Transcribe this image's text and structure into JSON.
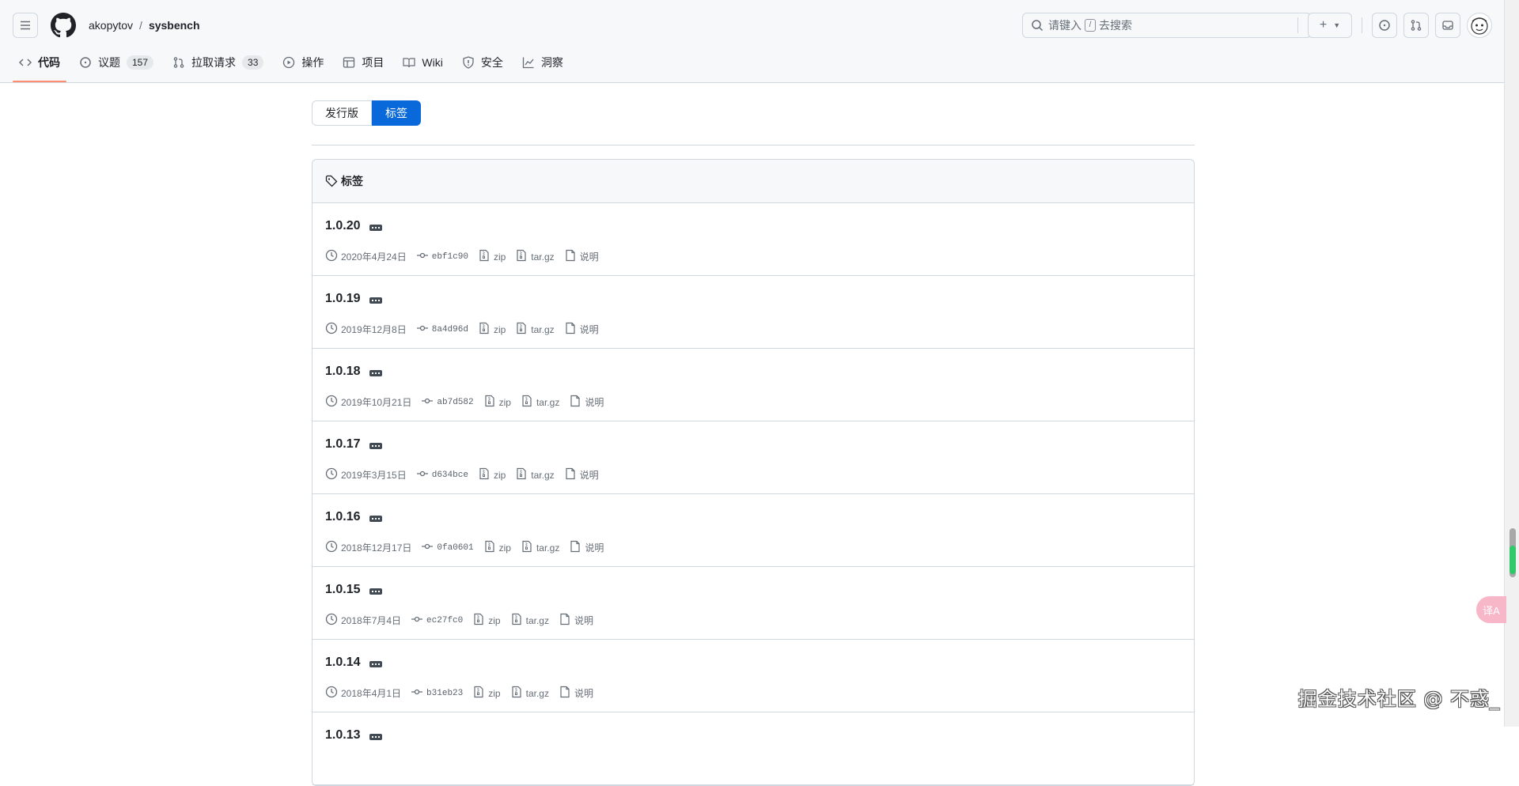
{
  "repo": {
    "owner": "akopytov",
    "separator": "/",
    "name": "sysbench"
  },
  "search": {
    "prefix": "请键入",
    "key": "/",
    "suffix": "去搜索"
  },
  "nav": {
    "tabs": [
      {
        "label": "代码",
        "icon": "code-icon"
      },
      {
        "label": "议题",
        "icon": "issue-icon",
        "count": "157"
      },
      {
        "label": "拉取请求",
        "icon": "pull-request-icon",
        "count": "33"
      },
      {
        "label": "操作",
        "icon": "play-icon"
      },
      {
        "label": "项目",
        "icon": "table-icon"
      },
      {
        "label": "Wiki",
        "icon": "book-icon"
      },
      {
        "label": "安全",
        "icon": "shield-icon"
      },
      {
        "label": "洞察",
        "icon": "graph-icon"
      }
    ]
  },
  "segmented": {
    "releases": "发行版",
    "tags": "标签"
  },
  "box": {
    "title": "标签"
  },
  "tags": [
    {
      "name": "1.0.20",
      "date": "2020年4月24日",
      "sha": "ebf1c90",
      "zip": "zip",
      "targz": "tar.gz",
      "notes": "说明"
    },
    {
      "name": "1.0.19",
      "date": "2019年12月8日",
      "sha": "8a4d96d",
      "zip": "zip",
      "targz": "tar.gz",
      "notes": "说明"
    },
    {
      "name": "1.0.18",
      "date": "2019年10月21日",
      "sha": "ab7d582",
      "zip": "zip",
      "targz": "tar.gz",
      "notes": "说明"
    },
    {
      "name": "1.0.17",
      "date": "2019年3月15日",
      "sha": "d634bce",
      "zip": "zip",
      "targz": "tar.gz",
      "notes": "说明"
    },
    {
      "name": "1.0.16",
      "date": "2018年12月17日",
      "sha": "0fa0601",
      "zip": "zip",
      "targz": "tar.gz",
      "notes": "说明"
    },
    {
      "name": "1.0.15",
      "date": "2018年7月4日",
      "sha": "ec27fc0",
      "zip": "zip",
      "targz": "tar.gz",
      "notes": "说明"
    },
    {
      "name": "1.0.14",
      "date": "2018年4月1日",
      "sha": "b31eb23",
      "zip": "zip",
      "targz": "tar.gz",
      "notes": "说明"
    },
    {
      "name": "1.0.13",
      "date": "",
      "sha": "",
      "zip": "",
      "targz": "",
      "notes": ""
    }
  ],
  "overlay": {
    "translate_label": "译A",
    "watermark": "掘金技术社区 @ 不惑_"
  },
  "colors": {
    "accent": "#0969da",
    "tab_underline": "#fd8c73",
    "border": "#d0d7de",
    "muted": "#656d76"
  }
}
